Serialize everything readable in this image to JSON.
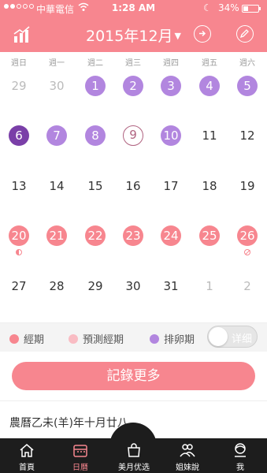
{
  "status_bar": {
    "carrier": "中華電信",
    "time": "1:28 AM",
    "battery": "34%"
  },
  "header": {
    "title": "2015年12月"
  },
  "weekdays": [
    "週日",
    "週一",
    "週二",
    "週三",
    "週四",
    "週五",
    "週六"
  ],
  "calendar": {
    "weeks": [
      [
        {
          "day": "29",
          "type": "muted"
        },
        {
          "day": "30",
          "type": "muted"
        },
        {
          "day": "1",
          "type": "ovulation"
        },
        {
          "day": "2",
          "type": "ovulation"
        },
        {
          "day": "3",
          "type": "ovulation"
        },
        {
          "day": "4",
          "type": "ovulation"
        },
        {
          "day": "5",
          "type": "ovulation"
        }
      ],
      [
        {
          "day": "6",
          "type": "ovulation-today"
        },
        {
          "day": "7",
          "type": "ovulation"
        },
        {
          "day": "8",
          "type": "ovulation"
        },
        {
          "day": "9",
          "type": "ovulation-ring"
        },
        {
          "day": "10",
          "type": "ovulation"
        },
        {
          "day": "11",
          "type": "normal"
        },
        {
          "day": "12",
          "type": "normal"
        }
      ],
      [
        {
          "day": "13",
          "type": "normal"
        },
        {
          "day": "14",
          "type": "normal"
        },
        {
          "day": "15",
          "type": "normal"
        },
        {
          "day": "16",
          "type": "normal"
        },
        {
          "day": "17",
          "type": "normal"
        },
        {
          "day": "18",
          "type": "normal"
        },
        {
          "day": "19",
          "type": "normal"
        }
      ],
      [
        {
          "day": "20",
          "type": "period",
          "mark": "half-circle"
        },
        {
          "day": "21",
          "type": "period"
        },
        {
          "day": "22",
          "type": "period"
        },
        {
          "day": "23",
          "type": "period"
        },
        {
          "day": "24",
          "type": "period"
        },
        {
          "day": "25",
          "type": "period"
        },
        {
          "day": "26",
          "type": "period",
          "mark": "no-sign"
        }
      ],
      [
        {
          "day": "27",
          "type": "normal"
        },
        {
          "day": "28",
          "type": "normal"
        },
        {
          "day": "29",
          "type": "normal"
        },
        {
          "day": "30",
          "type": "normal"
        },
        {
          "day": "31",
          "type": "normal"
        },
        {
          "day": "1",
          "type": "muted"
        },
        {
          "day": "2",
          "type": "muted"
        }
      ]
    ]
  },
  "legend": {
    "period": "經期",
    "predicted_period": "預測經期",
    "ovulation": "排卵期",
    "toggle_label": "详细"
  },
  "colors": {
    "brand": "#f7868f",
    "predicted": "#f9bcc3",
    "ovulation": "#b286df",
    "today": "#7a3fa8"
  },
  "record_button": "記錄更多",
  "lunar_date": "農曆乙未(羊)年十月廿八",
  "tabbar": {
    "items": [
      {
        "label": "首頁",
        "icon": "home-icon"
      },
      {
        "label": "日曆",
        "icon": "calendar-icon"
      },
      {
        "label": "美月优选",
        "icon": "shopping-bag-icon"
      },
      {
        "label": "姐妹說",
        "icon": "people-icon"
      },
      {
        "label": "我",
        "icon": "profile-icon"
      }
    ]
  }
}
